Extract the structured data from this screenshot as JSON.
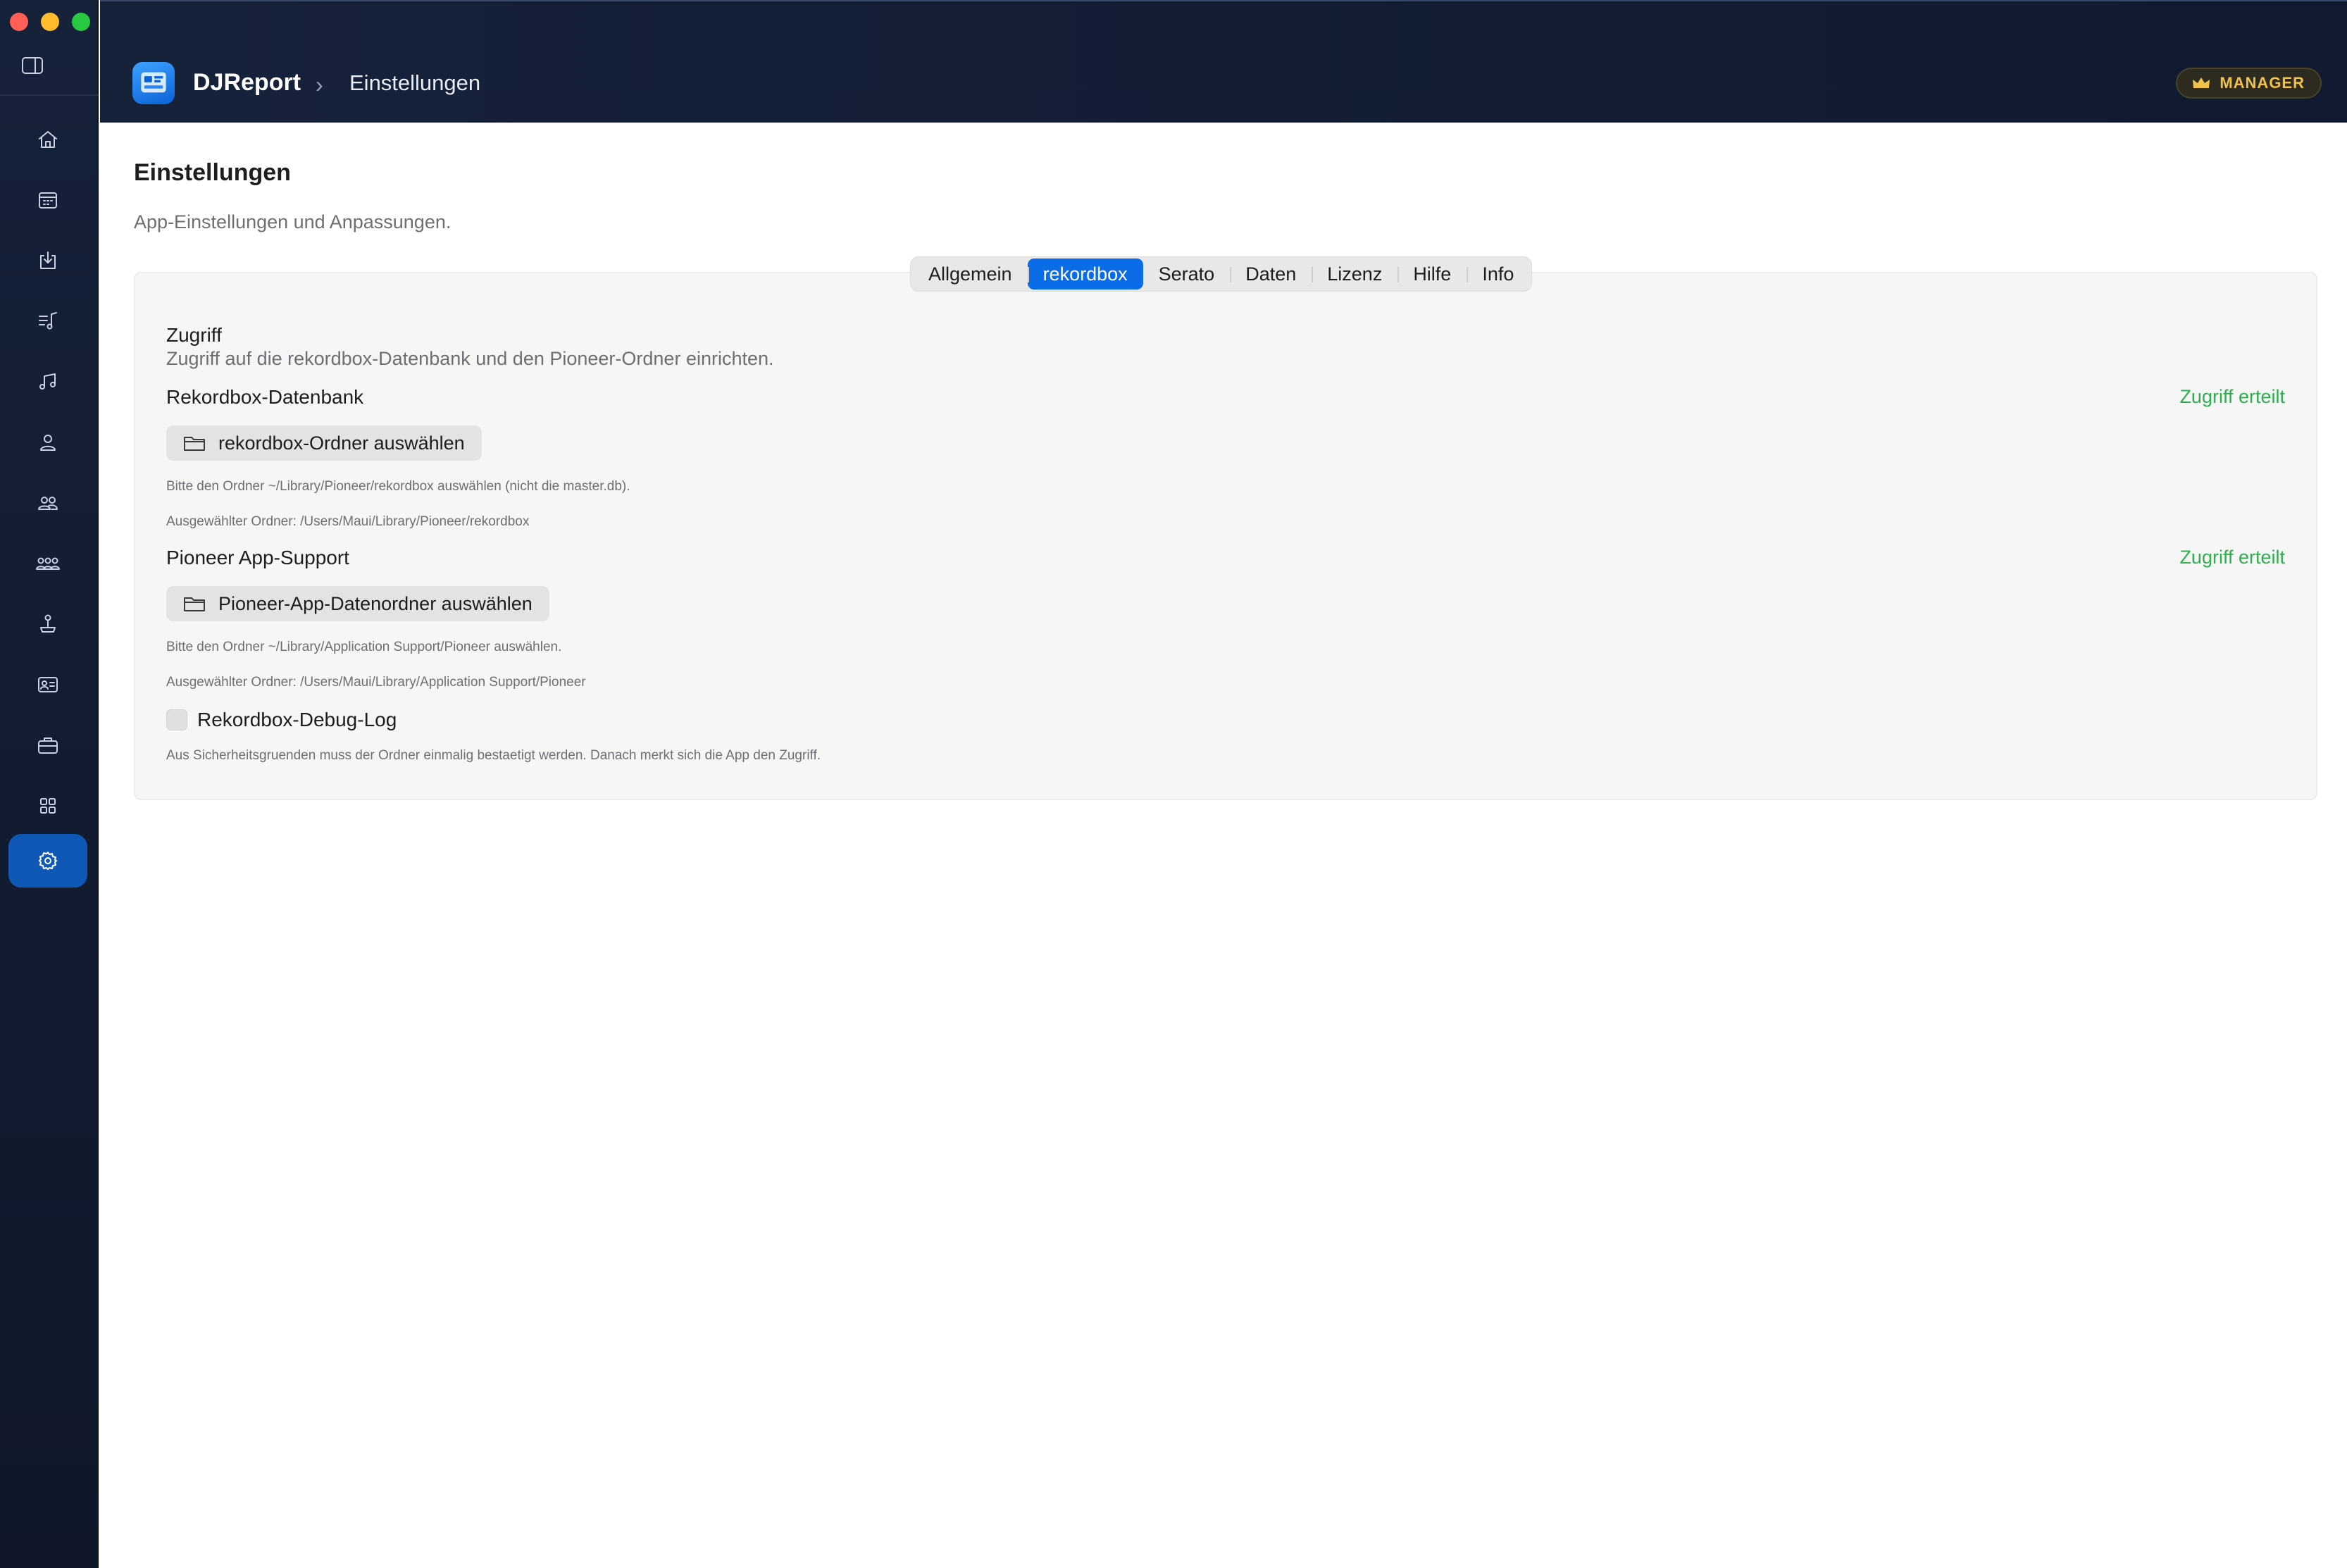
{
  "app": {
    "name": "DJReport",
    "breadcrumb_separator": "›",
    "breadcrumb_current": "Einstellungen",
    "badge_label": "MANAGER",
    "accent_color": "#0a6ce6",
    "badge_color": "#f2c14b",
    "success_color": "#2fae4e"
  },
  "sidebar": {
    "toggle_icon": "sidebar-toggle-icon",
    "items": [
      {
        "id": "home",
        "icon": "home-icon"
      },
      {
        "id": "calendar",
        "icon": "calendar-icon"
      },
      {
        "id": "import",
        "icon": "tray-download-icon"
      },
      {
        "id": "playlists",
        "icon": "music-list-icon"
      },
      {
        "id": "tracks",
        "icon": "music-notes-icon"
      },
      {
        "id": "person",
        "icon": "person-icon"
      },
      {
        "id": "people",
        "icon": "two-people-icon"
      },
      {
        "id": "groups",
        "icon": "group-icon"
      },
      {
        "id": "joystick",
        "icon": "joystick-icon"
      },
      {
        "id": "contact-card",
        "icon": "contact-card-icon"
      },
      {
        "id": "briefcase",
        "icon": "briefcase-icon"
      },
      {
        "id": "apps",
        "icon": "grid-icon"
      },
      {
        "id": "settings",
        "icon": "gear-icon",
        "active": true
      }
    ]
  },
  "page": {
    "title": "Einstellungen",
    "subtitle": "App-Einstellungen und Anpassungen."
  },
  "tabs": [
    {
      "label": "Allgemein",
      "active": false
    },
    {
      "label": "rekordbox",
      "active": true
    },
    {
      "label": "Serato",
      "active": false
    },
    {
      "label": "Daten",
      "active": false
    },
    {
      "label": "Lizenz",
      "active": false
    },
    {
      "label": "Hilfe",
      "active": false
    },
    {
      "label": "Info",
      "active": false
    }
  ],
  "access": {
    "title": "Zugriff",
    "subtitle": "Zugriff auf die rekordbox-Datenbank und den Pioneer-Ordner einrichten.",
    "rekordbox": {
      "label": "Rekordbox-Datenbank",
      "status": "Zugriff erteilt",
      "button": "rekordbox-Ordner auswählen",
      "hint": "Bitte den Ordner ~/Library/Pioneer/rekordbox auswählen (nicht die master.db).",
      "selected": "Ausgewählter Ordner: /Users/Maui/Library/Pioneer/rekordbox"
    },
    "pioneer": {
      "label": "Pioneer App-Support",
      "status": "Zugriff erteilt",
      "button": "Pioneer-App-Datenordner auswählen",
      "hint": "Bitte den Ordner ~/Library/Application Support/Pioneer auswählen.",
      "selected": "Ausgewählter Ordner: /Users/Maui/Library/Application Support/Pioneer"
    },
    "debug_log": {
      "label": "Rekordbox-Debug-Log",
      "checked": false
    },
    "footnote": "Aus Sicherheitsgruenden muss der Ordner einmalig bestaetigt werden. Danach merkt sich die App den Zugriff."
  }
}
